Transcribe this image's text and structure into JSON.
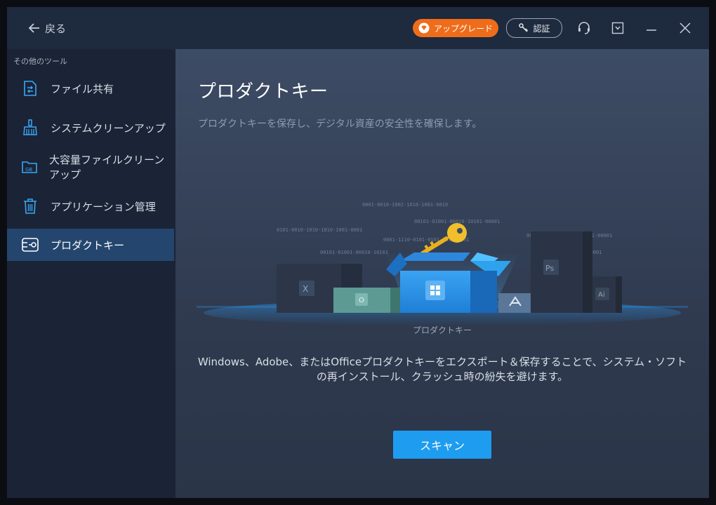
{
  "titlebar": {
    "back_label": "戻る",
    "upgrade_label": "アップグレード",
    "auth_label": "認証"
  },
  "sidebar": {
    "section_label": "その他のツール",
    "items": [
      {
        "label": "ファイル共有",
        "icon": "file-share-icon"
      },
      {
        "label": "システムクリーンアップ",
        "icon": "broom-icon"
      },
      {
        "label": "大容量ファイルクリーンアップ",
        "icon": "gb-folder-icon"
      },
      {
        "label": "アプリケーション管理",
        "icon": "trash-icon"
      },
      {
        "label": "プロダクトキー",
        "icon": "key-drive-icon",
        "active": true
      }
    ]
  },
  "main": {
    "title": "プロダクトキー",
    "subtitle": "プロダクトキーを保存し、デジタル資産の安全性を確保します。",
    "illustration": {
      "caption": "プロダクトキー",
      "binary_lines": [
        "0001-0010-1002-1010-1001-0010",
        "00101-01001-00010-10101-00001",
        "0101-0010-1010-1010-1001-0001",
        "0001-1110-0101-0101-1010-0101",
        "00101-01001-00010-10101-00001",
        "00101-01001-00010-10101",
        "10101-01001-0001"
      ],
      "app_labels": {
        "excel": "X",
        "outlook": "O",
        "photoshop": "Ps",
        "illustrator": "Ai"
      }
    },
    "description": "Windows、Adobe、またはOfficeプロダクトキーをエクスポート＆保存することで、システム・ソフトの再インストール、クラッシュ時の紛失を避けます。",
    "scan_label": "スキャン"
  },
  "colors": {
    "accent": "#1e9cf0",
    "upgrade": "#ef6c1a",
    "active_nav": "#24466e",
    "key": "#e8b01e"
  }
}
